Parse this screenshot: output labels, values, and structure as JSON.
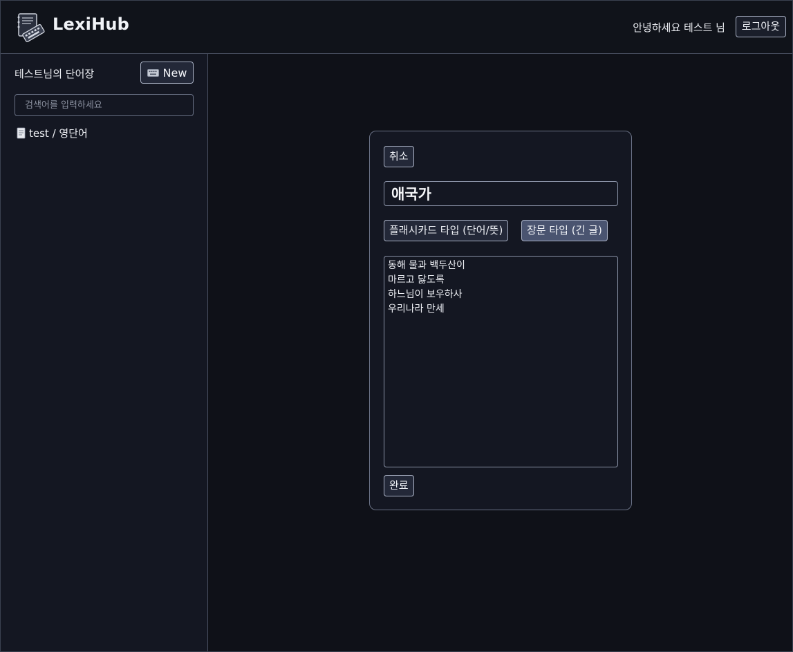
{
  "header": {
    "app_title": "LexiHub",
    "greeting": "안녕하세요 테스트 님",
    "logout_label": "로그아웃"
  },
  "sidebar": {
    "title": "테스트님의 단어장",
    "new_label": "New",
    "search_placeholder": "검색어를 입력하세요",
    "search_value": "",
    "items": [
      {
        "label": "test / 영단어",
        "icon": "document-icon"
      }
    ]
  },
  "editor": {
    "cancel_label": "취소",
    "title_value": "애국가",
    "type_flashcard_label": "플래시카드 타입 (단어/뜻)",
    "type_long_label": "장문 타입 (긴 글)",
    "selected_type": "long",
    "content": "동해 물과 백두산이\n마르고 닳도록\n하느님이 보우하사\n우리나라 만세",
    "done_label": "완료"
  },
  "colors": {
    "background": "#0f1118",
    "panel": "#141722",
    "border": "#6a7286",
    "selected_type_bg": "#4a5470"
  }
}
